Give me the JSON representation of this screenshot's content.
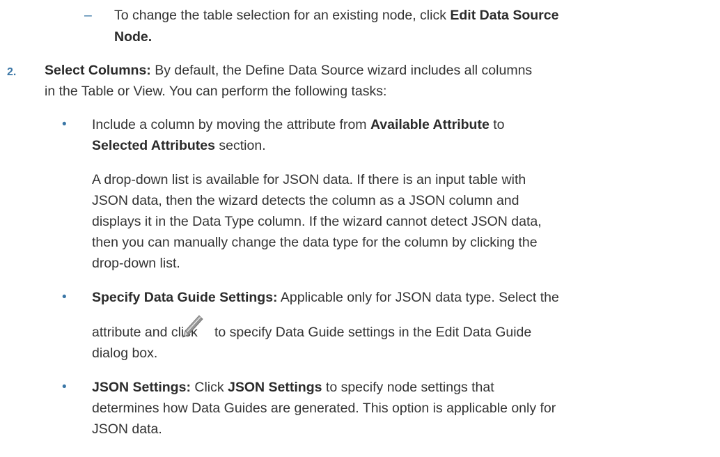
{
  "sub_item": {
    "marker": "–",
    "line1_text": "To change the table selection for an existing node, click ",
    "line1_bold": "Edit Data Source",
    "line2_bold": "Node."
  },
  "step2": {
    "number": "2.",
    "title": "Select Columns:",
    "text_line1": " By default, the Define Data Source wizard includes all columns",
    "text_line2": "in the Table or View. You can perform the following tasks:"
  },
  "bullets": [
    {
      "marker": "•",
      "line1_text": "Include a column by moving the attribute from ",
      "line1_bold": "Available Attribute",
      "line1_tail": " to",
      "line2_bold": "Selected Attributes",
      "line2_tail": " section."
    },
    {
      "marker": "•",
      "title": "Specify Data Guide Settings:",
      "line1_text": " Applicable only for JSON data type. Select the",
      "line2_pre": "attribute and click ",
      "line2_post": " to specify Data Guide settings in the Edit Data Guide",
      "line3": "dialog box.",
      "icon": "pencil-icon"
    },
    {
      "marker": "•",
      "title": "JSON Settings:",
      "line1_mid": " Click ",
      "line1_bold": "JSON Settings",
      "line1_tail": " to specify node settings that",
      "line2": "determines how Data Guides are generated. This option is applicable only for",
      "line3": "JSON data."
    }
  ],
  "json_paragraph": {
    "lines": [
      "A drop-down list is available for JSON data. If there is an input table with",
      "JSON data, then the wizard detects the column as a JSON column and",
      "displays it in the Data Type column. If the wizard cannot detect JSON data,",
      "then you can manually change the data type for the column by clicking the",
      "drop-down list."
    ]
  },
  "colors": {
    "marker": "#3a76a6",
    "text": "#333333"
  }
}
